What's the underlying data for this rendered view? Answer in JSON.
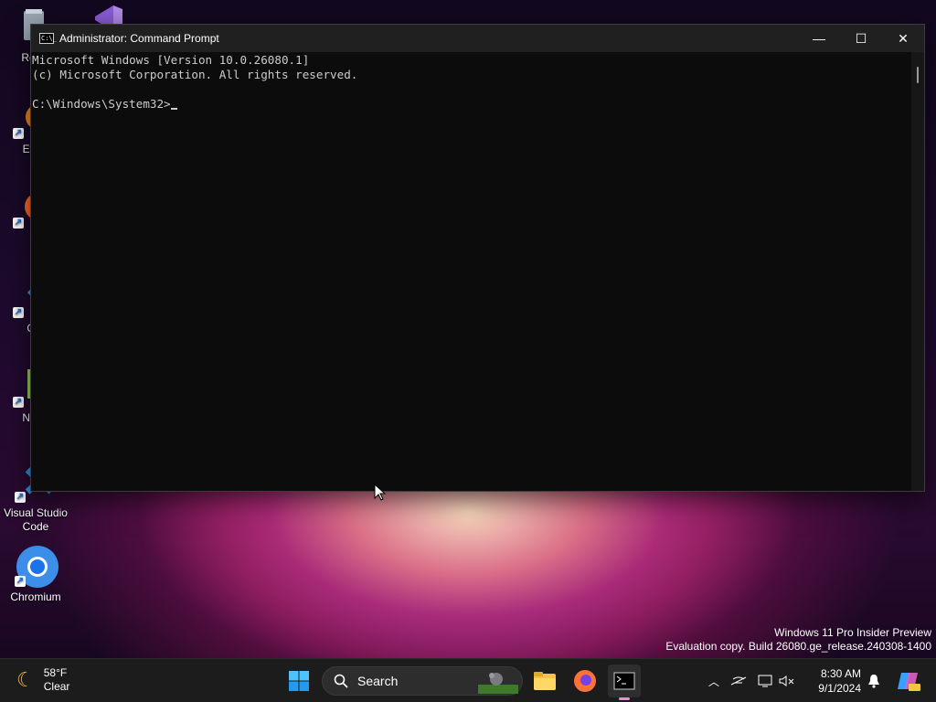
{
  "desktop_icons": [
    {
      "name": "recycle-bin",
      "label": "Recy"
    },
    {
      "name": "visual-studio",
      "label": ""
    },
    {
      "name": "everything",
      "label": "Ever"
    },
    {
      "name": "firefox",
      "label": "Fi"
    },
    {
      "name": "git",
      "label": "Git"
    },
    {
      "name": "notepad",
      "label": "Note"
    },
    {
      "name": "vscode",
      "label": "Visual Studio Code"
    },
    {
      "name": "chromium",
      "label": "Chromium"
    }
  ],
  "window": {
    "title": "Administrator: Command Prompt",
    "icon_text": "C:\\_",
    "controls": {
      "minimize": "—",
      "maximize": "☐",
      "close": "✕"
    },
    "console_lines": [
      "Microsoft Windows [Version 10.0.26080.1]",
      "(c) Microsoft Corporation. All rights reserved.",
      "",
      "C:\\Windows\\System32>"
    ]
  },
  "watermark": {
    "line1": "Windows 11 Pro Insider Preview",
    "line2": "Evaluation copy. Build 26080.ge_release.240308-1400"
  },
  "taskbar": {
    "weather": {
      "temp": "58°F",
      "condition": "Clear"
    },
    "search_placeholder": "Search",
    "clock": {
      "time": "8:30 AM",
      "date": "9/1/2024"
    }
  },
  "colors": {
    "accent": "#0078d4",
    "console_bg": "#0c0c0c",
    "console_text": "#cccccc",
    "taskbar": "#1c1c1c"
  }
}
